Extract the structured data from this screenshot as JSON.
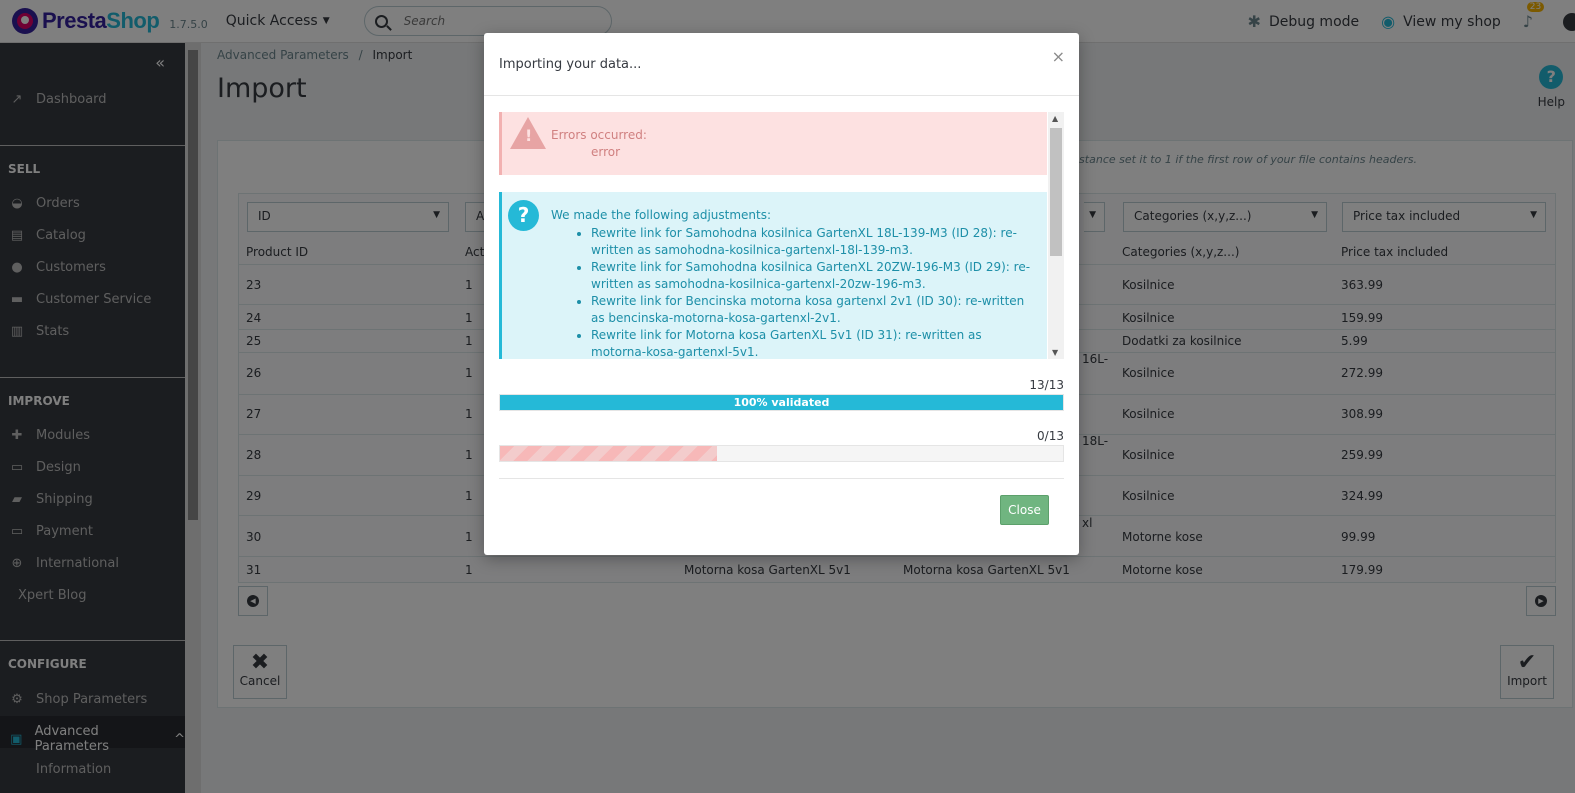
{
  "header": {
    "logo_text_1": "Presta",
    "logo_text_2": "Shop",
    "version": "1.7.5.0",
    "quick_access": "Quick Access",
    "search_placeholder": "Search",
    "debug_mode": "Debug mode",
    "view_shop": "View my shop",
    "notifications": "23"
  },
  "sidebar": {
    "dashboard": "Dashboard",
    "sell": "SELL",
    "orders": "Orders",
    "catalog": "Catalog",
    "customers": "Customers",
    "customer_service": "Customer Service",
    "stats": "Stats",
    "improve": "IMPROVE",
    "modules": "Modules",
    "design": "Design",
    "shipping": "Shipping",
    "payment": "Payment",
    "international": "International",
    "xpert_blog": "Xpert Blog",
    "configure": "CONFIGURE",
    "shop_parameters": "Shop Parameters",
    "advanced_parameters": "Advanced Parameters",
    "information": "Information"
  },
  "page": {
    "breadcrumb_parent": "Advanced Parameters",
    "breadcrumb_sep": "/",
    "breadcrumb_current": "Import",
    "title": "Import",
    "help": "Help",
    "hint": "istance set it to 1 if the first row of your file contains headers."
  },
  "table": {
    "selects": [
      "ID",
      "A",
      "Categories (x,y,z...)",
      "Price tax included"
    ],
    "headers": [
      "Product ID",
      "Act",
      "Categories (x,y,z...)",
      "Price tax included"
    ],
    "rows": [
      {
        "id": "23",
        "active": "1",
        "name": "",
        "name2": "",
        "category": "Kosilnice",
        "price": "363.99"
      },
      {
        "id": "24",
        "active": "1",
        "name": "",
        "name2": "",
        "category": "Kosilnice",
        "price": "159.99"
      },
      {
        "id": "25",
        "active": "1",
        "name": "",
        "name2": "",
        "category": "Dodatki za kosilnice",
        "price": "5.99"
      },
      {
        "id": "26",
        "active": "1",
        "name": "",
        "name2": "16L-",
        "category": "Kosilnice",
        "price": "272.99"
      },
      {
        "id": "27",
        "active": "1",
        "name": "",
        "name2": "",
        "category": "Kosilnice",
        "price": "308.99"
      },
      {
        "id": "28",
        "active": "1",
        "name": "",
        "name2": "18L-",
        "category": "Kosilnice",
        "price": "259.99"
      },
      {
        "id": "29",
        "active": "1",
        "name": "",
        "name2": "",
        "category": "Kosilnice",
        "price": "324.99"
      },
      {
        "id": "30",
        "active": "1",
        "name": "",
        "name2": "xl",
        "category": "Motorne kose",
        "price": "99.99"
      },
      {
        "id": "31",
        "active": "1",
        "name": "Motorna kosa GartenXL 5v1",
        "name2": "Motorna kosa GartenXL 5v1",
        "category": "Motorne kose",
        "price": "179.99"
      }
    ]
  },
  "footer": {
    "cancel": "Cancel",
    "import": "Import"
  },
  "modal": {
    "title": "Importing your data...",
    "close_x": "×",
    "error_title": "Errors occurred:",
    "error_detail": "error",
    "info_title": "We made the following adjustments:",
    "adjustments": [
      "Rewrite link for Samohodna kosilnica GartenXL 18L-139-M3 (ID 28): re-written as samohodna-kosilnica-gartenxl-18l-139-m3.",
      "Rewrite link for Samohodna kosilnica GartenXL 20ZW-196-M3 (ID 29): re-written as samohodna-kosilnica-gartenxl-20zw-196-m3.",
      "Rewrite link for Bencinska motorna kosa gartenxl 2v1 (ID 30): re-written as bencinska-motorna-kosa-gartenxl-2v1.",
      "Rewrite link for Motorna kosa GartenXL 5v1 (ID 31): re-written as motorna-kosa-gartenxl-5v1."
    ],
    "validated_count": "13/13",
    "validated_label": "100% validated",
    "validated_fraction": 1.0,
    "imported_count": "0/13",
    "imported_fraction": 0.385,
    "close_button": "Close"
  },
  "colors": {
    "accent": "#25b9d7",
    "sidebar_bg": "#363a41",
    "error_bg": "#fde1e1",
    "info_bg": "#dcf4f9",
    "success": "#70b580"
  }
}
